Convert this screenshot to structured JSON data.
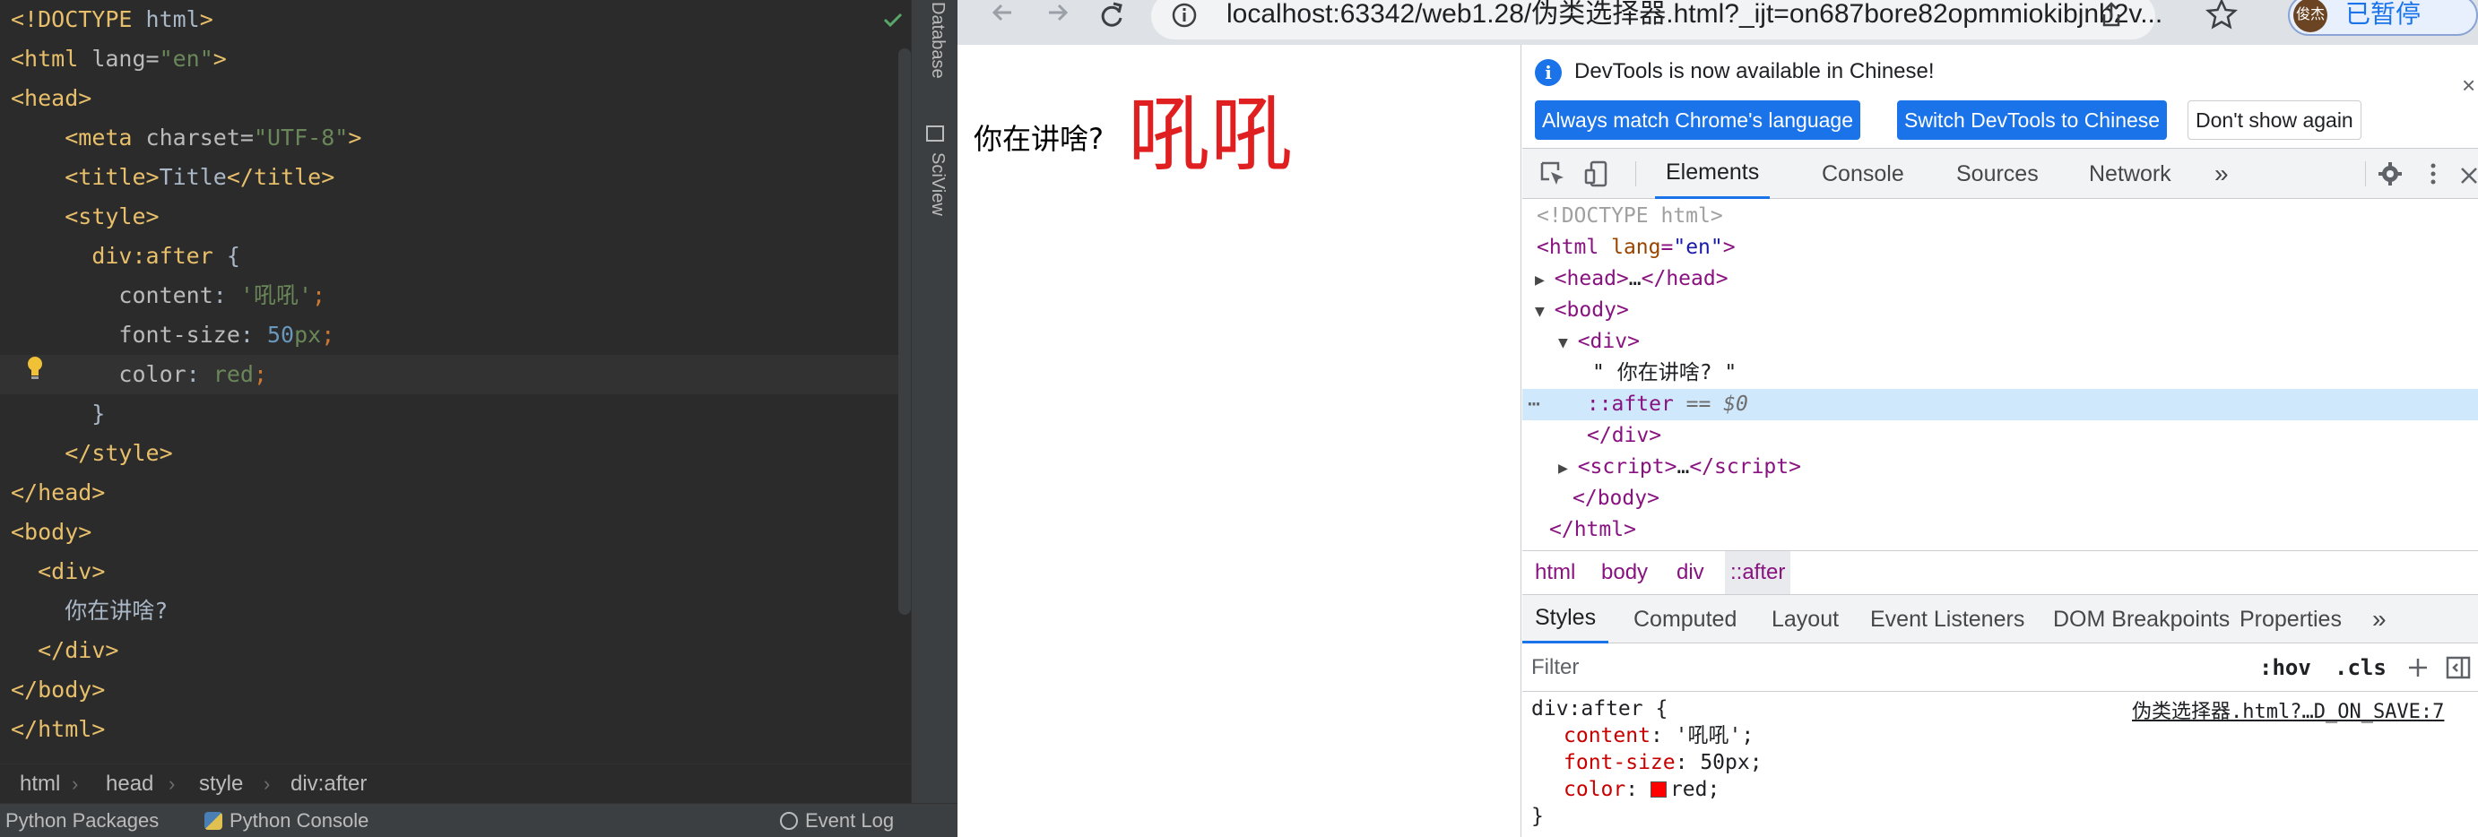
{
  "ide": {
    "editor_lines": [
      [
        [
          "tok-doctype",
          "<!DOCTYPE "
        ],
        [
          "tok-plain",
          "html"
        ],
        [
          "tok-doctype",
          ">"
        ]
      ],
      [
        [
          "tok-tag",
          "<html "
        ],
        [
          "tok-attr",
          "lang="
        ],
        [
          "tok-str",
          "\"en\""
        ],
        [
          "tok-tag",
          ">"
        ]
      ],
      [
        [
          "tok-tag",
          "<head>"
        ]
      ],
      [
        [
          "tok-plain",
          "    "
        ],
        [
          "tok-tag",
          "<meta "
        ],
        [
          "tok-attr",
          "charset="
        ],
        [
          "tok-str",
          "\"UTF-8\""
        ],
        [
          "tok-tag",
          ">"
        ]
      ],
      [
        [
          "tok-plain",
          "    "
        ],
        [
          "tok-tag",
          "<title>"
        ],
        [
          "tok-plain",
          "Title"
        ],
        [
          "tok-tag",
          "</title>"
        ]
      ],
      [
        [
          "tok-plain",
          "    "
        ],
        [
          "tok-tag",
          "<style>"
        ]
      ],
      [
        [
          "tok-plain",
          "      "
        ],
        [
          "tok-sel",
          "div:after "
        ],
        [
          "tok-plain",
          "{"
        ]
      ],
      [
        [
          "tok-plain",
          "        "
        ],
        [
          "tok-prop",
          "content"
        ],
        [
          "tok-plain",
          ": "
        ],
        [
          "tok-str",
          "'吼吼'"
        ],
        [
          "tok-kw",
          ";"
        ]
      ],
      [
        [
          "tok-plain",
          "        "
        ],
        [
          "tok-prop",
          "font-size"
        ],
        [
          "tok-plain",
          ": "
        ],
        [
          "tok-num",
          "50"
        ],
        [
          "tok-str",
          "px"
        ],
        [
          "tok-kw",
          ";"
        ]
      ],
      [
        [
          "tok-plain",
          "        "
        ],
        [
          "tok-prop",
          "color"
        ],
        [
          "tok-plain",
          ": "
        ],
        [
          "tok-str",
          "red"
        ],
        [
          "tok-kw",
          ";"
        ]
      ],
      [
        [
          "tok-plain",
          "      }"
        ]
      ],
      [
        [
          "tok-plain",
          "    "
        ],
        [
          "tok-tag",
          "</style>"
        ]
      ],
      [
        [
          "tok-tag",
          "</head>"
        ]
      ],
      [
        [
          "tok-tag",
          "<body>"
        ]
      ],
      [
        [
          "tok-plain",
          "  "
        ],
        [
          "tok-tag",
          "<div>"
        ]
      ],
      [
        [
          "tok-plain",
          "    你在讲啥?"
        ]
      ],
      [
        [
          "tok-plain",
          "  "
        ],
        [
          "tok-tag",
          "</div>"
        ]
      ],
      [
        [
          "tok-tag",
          "</body>"
        ]
      ],
      [
        [
          "tok-tag",
          "</html>"
        ]
      ]
    ],
    "breadcrumbs": [
      "html",
      "head",
      "style",
      "div:after"
    ],
    "bottom_bar": {
      "python_packages": "Python Packages",
      "python_console": "Python Console",
      "event_log": "Event Log"
    },
    "side_tabs": {
      "database": "Database",
      "sciview": "SciView"
    }
  },
  "browser": {
    "url": "localhost:63342/web1.28/伪类选择器.html?_ijt=on687bore82opmmiokibjnb2v...",
    "profile_avatar": "俊杰",
    "profile_label": "已暂停",
    "page": {
      "div_text": "你在讲啥?",
      "after_content": "吼吼"
    }
  },
  "devtools": {
    "info_message": "DevTools is now available in Chinese!",
    "btn_match": "Always match Chrome's language",
    "btn_switch": "Switch DevTools to Chinese",
    "btn_dont_show": "Don't show again",
    "tabs": [
      "Elements",
      "Console",
      "Sources",
      "Network"
    ],
    "more_tabs": "»",
    "dom": {
      "doctype": "<!DOCTYPE html>",
      "html_open_tag": "html",
      "html_lang_attr": "lang",
      "html_lang_val": "\"en\"",
      "head_collapsed": "…",
      "body_tag": "body",
      "div_tag": "div",
      "div_text": "\" 你在讲啥? \"",
      "after_pseudo": "::after",
      "after_ref": "== $0",
      "script_collapsed": "…"
    },
    "crumbs": [
      "html",
      "body",
      "div",
      "::after"
    ],
    "subtabs": [
      "Styles",
      "Computed",
      "Layout",
      "Event Listeners",
      "DOM Breakpoints",
      "Properties"
    ],
    "filter_placeholder": "Filter",
    "hov": ":hov",
    "cls": ".cls",
    "rule": {
      "selector": "div:after {",
      "source": "伪类选择器.html?…D_ON_SAVE:7",
      "content_prop": "content",
      "content_val": "'吼吼';",
      "font_size_prop": "font-size",
      "font_size_val": "50px;",
      "color_prop": "color",
      "color_val": "red;",
      "close": "}"
    }
  },
  "colors": {
    "after_text": "#e02020",
    "devtools_accent": "#1a73e8",
    "ide_bg": "#2b2b2b"
  }
}
